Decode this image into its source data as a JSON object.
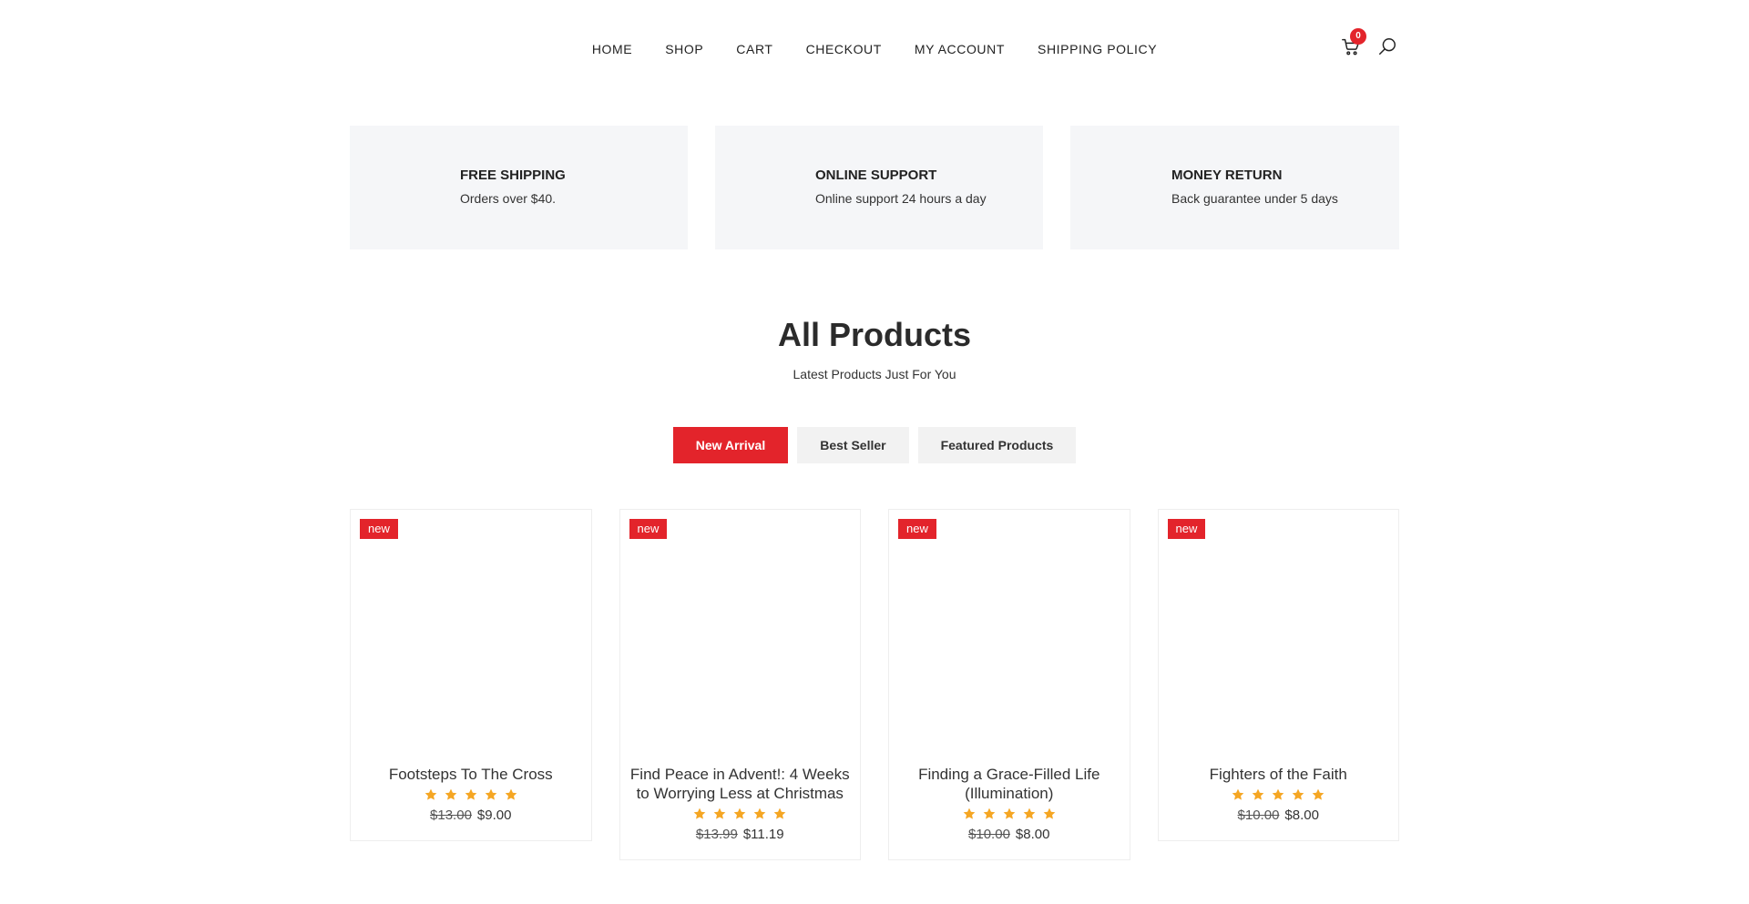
{
  "nav": {
    "items": [
      {
        "label": "HOME"
      },
      {
        "label": "SHOP"
      },
      {
        "label": "CART"
      },
      {
        "label": "CHECKOUT"
      },
      {
        "label": "MY ACCOUNT"
      },
      {
        "label": "SHIPPING POLICY"
      }
    ]
  },
  "header_icons": {
    "cart_icon": "cart-icon",
    "cart_count": "0",
    "search_icon": "search-icon"
  },
  "features": [
    {
      "title": "FREE SHIPPING",
      "text": "Orders over $40."
    },
    {
      "title": "ONLINE SUPPORT",
      "text": "Online support 24 hours a day"
    },
    {
      "title": "MONEY RETURN",
      "text": "Back guarantee under 5 days"
    }
  ],
  "section": {
    "title": "All Products",
    "subtitle": "Latest Products Just For You"
  },
  "tabs": [
    {
      "label": "New Arrival",
      "active": true
    },
    {
      "label": "Best Seller",
      "active": false
    },
    {
      "label": "Featured Products",
      "active": false
    }
  ],
  "products": [
    {
      "badge": "new",
      "title": "Footsteps To The Cross",
      "rating": 5,
      "old_price": "$13.00",
      "new_price": "$9.00"
    },
    {
      "badge": "new",
      "title": "Find Peace in Advent!: 4 Weeks to Worrying Less at Christmas",
      "rating": 5,
      "old_price": "$13.99",
      "new_price": "$11.19"
    },
    {
      "badge": "new",
      "title": "Finding a Grace-Filled Life (Illumination)",
      "rating": 5,
      "old_price": "$10.00",
      "new_price": "$8.00"
    },
    {
      "badge": "new",
      "title": "Fighters of the Faith",
      "rating": 5,
      "old_price": "$10.00",
      "new_price": "$8.00"
    }
  ],
  "colors": {
    "accent": "#e3242b",
    "star": "#f5a623",
    "feature_bg": "#f5f6f8",
    "tab_bg": "#f2f2f2"
  }
}
